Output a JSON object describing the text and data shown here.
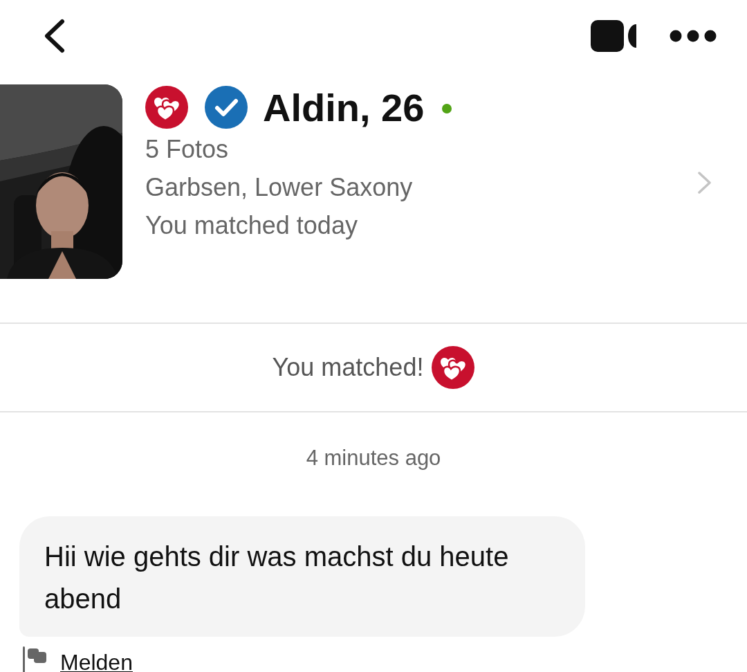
{
  "profile": {
    "name": "Aldin, 26",
    "verified": true,
    "online": true,
    "photos": "5 Fotos",
    "location": "Garbsen, Lower Saxony",
    "matched": "You matched today"
  },
  "match_banner": {
    "text": "You matched!"
  },
  "messages": [
    {
      "time": "4 minutes ago",
      "text": "Hii wie gehts dir was machst du heute abend",
      "report": "Melden"
    }
  ]
}
